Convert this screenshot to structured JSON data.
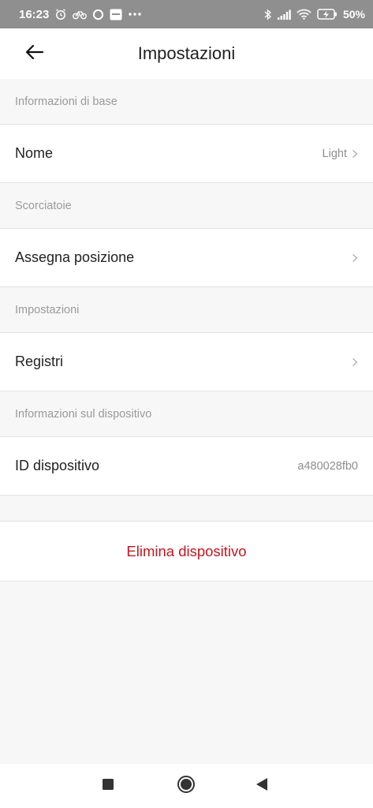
{
  "status_bar": {
    "time": "16:23",
    "battery_percent": "50%",
    "icons_left": [
      "alarm-icon",
      "bike-icon",
      "circle-icon",
      "app-icon",
      "more-dots-icon"
    ],
    "icons_right": [
      "bluetooth-icon",
      "signal-icon",
      "wifi-icon",
      "battery-icon"
    ]
  },
  "header": {
    "title": "Impostazioni",
    "back_icon": "arrow-left-icon"
  },
  "sections": {
    "basic_info": {
      "title": "Informazioni di base",
      "rows": {
        "name": {
          "label": "Nome",
          "value": "Light"
        }
      }
    },
    "shortcuts": {
      "title": "Scorciatoie",
      "rows": {
        "assign_position": {
          "label": "Assegna posizione"
        }
      }
    },
    "settings": {
      "title": "Impostazioni",
      "rows": {
        "logs": {
          "label": "Registri"
        }
      }
    },
    "device_info": {
      "title": "Informazioni sul dispositivo",
      "rows": {
        "device_id": {
          "label": "ID dispositivo",
          "value": "a480028fb0"
        }
      }
    }
  },
  "actions": {
    "delete_device": "Elimina dispositivo"
  },
  "colors": {
    "accent_danger": "#c8141e",
    "status_bar_bg": "#8f8f8f",
    "page_bg": "#f7f7f7"
  },
  "nav_bar": {
    "icons": [
      "recents-square-icon",
      "home-circle-icon",
      "back-triangle-icon"
    ]
  }
}
